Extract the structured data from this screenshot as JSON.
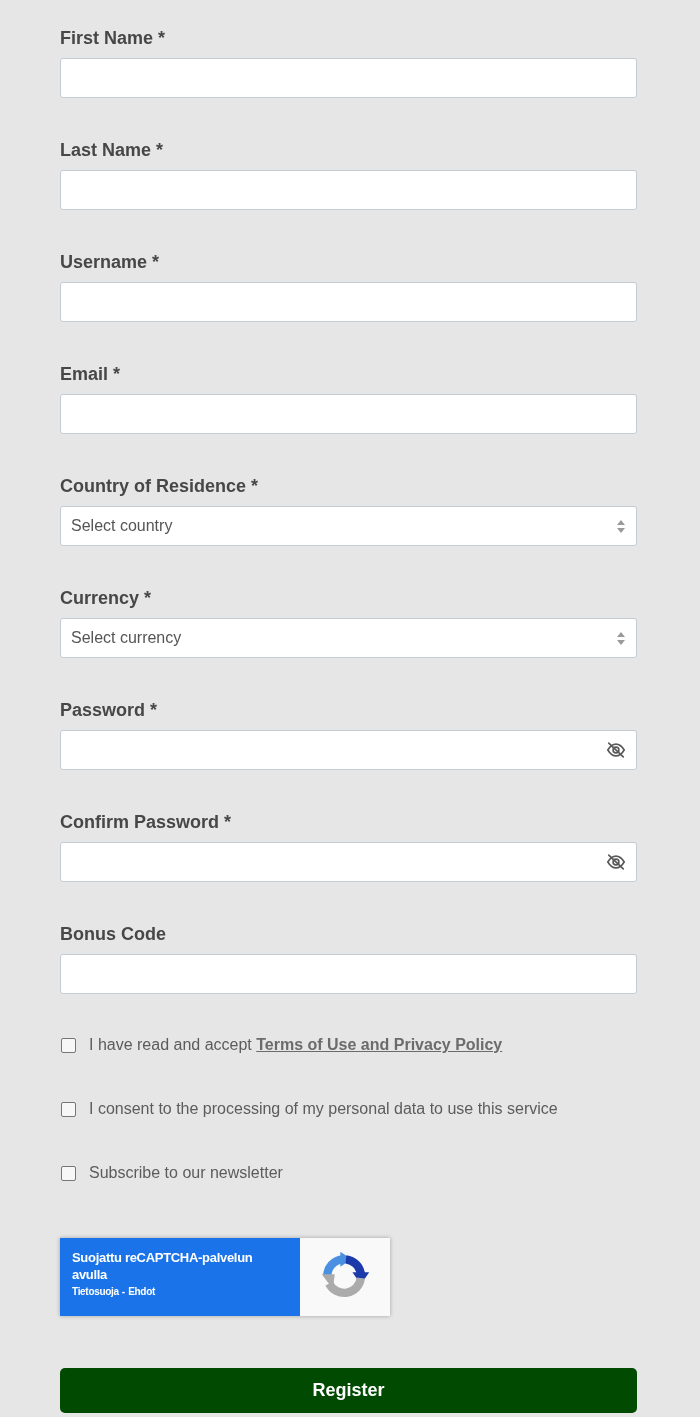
{
  "fields": [
    {
      "kind": "text",
      "label": "First Name *"
    },
    {
      "kind": "text",
      "label": "Last Name *"
    },
    {
      "kind": "text",
      "label": "Username *"
    },
    {
      "kind": "text",
      "label": "Email *"
    },
    {
      "kind": "select",
      "label": "Country of Residence *",
      "placeholder": "Select country"
    },
    {
      "kind": "select",
      "label": "Currency *",
      "placeholder": "Select currency"
    },
    {
      "kind": "password",
      "label": "Password *"
    },
    {
      "kind": "password",
      "label": "Confirm Password *"
    },
    {
      "kind": "text",
      "label": "Bonus Code"
    }
  ],
  "checkboxes": [
    {
      "text": "I have read and accept ",
      "link": "Terms of Use and Privacy Policy",
      "checked": false
    },
    {
      "text": "I consent to the processing of my personal data to use this service",
      "checked": false
    },
    {
      "text": "Subscribe to our newsletter",
      "checked": false
    }
  ],
  "recaptcha": {
    "text": "Suojattu reCAPTCHA-palvelun avulla",
    "links": [
      "Tietosuoja",
      "Ehdot"
    ],
    "separator": "-"
  },
  "submit_button": "Register"
}
